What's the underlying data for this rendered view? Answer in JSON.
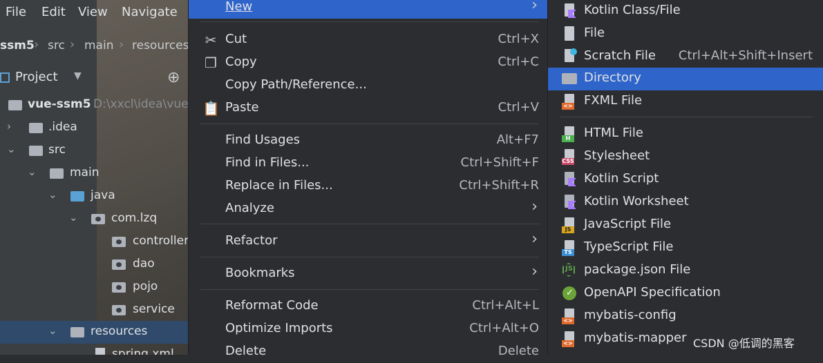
{
  "menubar": {
    "file": "File",
    "edit": "Edit",
    "view": "View",
    "navigate": "Navigate"
  },
  "breadcrumb": {
    "project": "ssm5",
    "src": "src",
    "main": "main",
    "resources": "resources"
  },
  "project_panel": {
    "title": "Project",
    "root_name": "vue-ssm5",
    "root_path": "D:\\xxcl\\idea\\vue"
  },
  "tree": [
    "vue-ssm5",
    ".idea",
    "src",
    "main",
    "java",
    "com.lzq",
    "controller",
    "dao",
    "pojo",
    "service",
    "resources",
    "spring.xml"
  ],
  "menu": {
    "new": "New",
    "cut": "Cut",
    "cut_sc": "Ctrl+X",
    "copy": "Copy",
    "copy_sc": "Ctrl+C",
    "copy_path": "Copy Path/Reference...",
    "paste": "Paste",
    "paste_sc": "Ctrl+V",
    "find_usages": "Find Usages",
    "find_usages_sc": "Alt+F7",
    "find_in_files": "Find in Files...",
    "find_in_files_sc": "Ctrl+Shift+F",
    "replace_in_files": "Replace in Files...",
    "replace_in_files_sc": "Ctrl+Shift+R",
    "analyze": "Analyze",
    "refactor": "Refactor",
    "bookmarks": "Bookmarks",
    "reformat": "Reformat Code",
    "reformat_sc": "Ctrl+Alt+L",
    "optimize": "Optimize Imports",
    "optimize_sc": "Ctrl+Alt+O",
    "delete": "Delete",
    "delete_sc": "Delete"
  },
  "submenu": {
    "kotlin_class": "Kotlin Class/File",
    "file": "File",
    "scratch": "Scratch File",
    "scratch_sc": "Ctrl+Alt+Shift+Insert",
    "directory": "Directory",
    "fxml": "FXML File",
    "html": "HTML File",
    "stylesheet": "Stylesheet",
    "kotlin_script": "Kotlin Script",
    "kotlin_worksheet": "Kotlin Worksheet",
    "js": "JavaScript File",
    "ts": "TypeScript File",
    "package_json": "package.json File",
    "openapi": "OpenAPI Specification",
    "mybatis_config": "mybatis-config",
    "mybatis_mapper": "mybatis-mapper"
  },
  "badges": {
    "html": "H",
    "css": "CSS",
    "js": "JS",
    "ts": "TS",
    "xml": "<>"
  },
  "watermark": "CSDN @低调的黑客",
  "colors": {
    "highlight": "#2f65ca",
    "menu_bg": "#2b2d30",
    "panel_bg": "#3c3f41",
    "selected_row": "#2f4a6b"
  }
}
